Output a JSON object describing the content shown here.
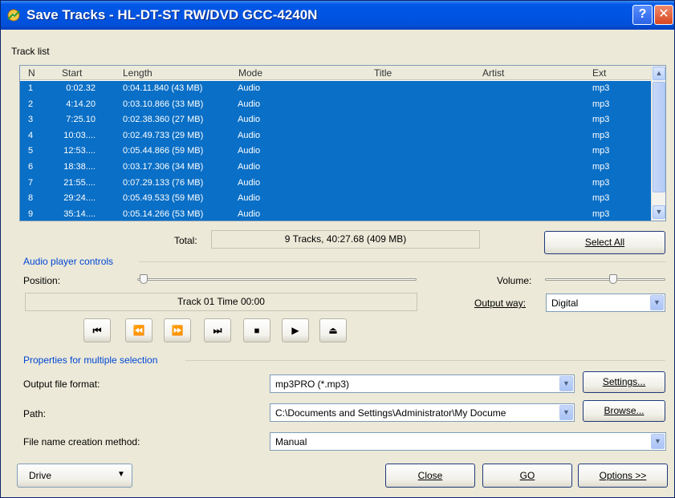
{
  "window": {
    "title": "Save Tracks - HL-DT-ST RW/DVD GCC-4240N",
    "help_label": "?",
    "close_label": "✕"
  },
  "track_list": {
    "label": "Track list",
    "columns": [
      "N",
      "Start",
      "Length",
      "Mode",
      "Title",
      "Artist",
      "Ext"
    ],
    "rows": [
      {
        "n": "1",
        "start": "0:02.32",
        "length": "0:04.11.840 (43 MB)",
        "mode": "Audio",
        "ext": "mp3"
      },
      {
        "n": "2",
        "start": "4:14.20",
        "length": "0:03.10.866 (33 MB)",
        "mode": "Audio",
        "ext": "mp3"
      },
      {
        "n": "3",
        "start": "7:25.10",
        "length": "0:02.38.360 (27 MB)",
        "mode": "Audio",
        "ext": "mp3"
      },
      {
        "n": "4",
        "start": "10:03....",
        "length": "0:02.49.733 (29 MB)",
        "mode": "Audio",
        "ext": "mp3"
      },
      {
        "n": "5",
        "start": "12:53....",
        "length": "0:05.44.866 (59 MB)",
        "mode": "Audio",
        "ext": "mp3"
      },
      {
        "n": "6",
        "start": "18:38....",
        "length": "0:03.17.306 (34 MB)",
        "mode": "Audio",
        "ext": "mp3"
      },
      {
        "n": "7",
        "start": "21:55....",
        "length": "0:07.29.133 (76 MB)",
        "mode": "Audio",
        "ext": "mp3"
      },
      {
        "n": "8",
        "start": "29:24....",
        "length": "0:05.49.533 (59 MB)",
        "mode": "Audio",
        "ext": "mp3"
      },
      {
        "n": "9",
        "start": "35:14....",
        "length": "0:05.14.266 (53 MB)",
        "mode": "Audio",
        "ext": "mp3"
      }
    ],
    "total_label": "Total:",
    "total_value": "9 Tracks,  40:27.68 (409 MB)",
    "select_all_label": "Select All"
  },
  "player": {
    "section_label": "Audio player controls",
    "position_label": "Position:",
    "volume_label": "Volume:",
    "status_text": "Track 01 Time 00:00",
    "output_way_label": "Output way:",
    "output_way_value": "Digital",
    "buttons": [
      "⏮",
      "⏪",
      "⏩",
      "⏭",
      "⏹",
      "▶",
      "⏏"
    ]
  },
  "properties": {
    "section_label": "Properties for multiple selection",
    "format_label": "Output file format:",
    "format_value": "mp3PRO (*.mp3)",
    "settings_label": "Settings...",
    "path_label": "Path:",
    "path_value": "C:\\Documents and Settings\\Administrator\\My Docume",
    "browse_label": "Browse...",
    "naming_label": "File name creation method:",
    "naming_value": "Manual"
  },
  "footer": {
    "drive_label": "Drive",
    "close_label": "Close",
    "go_label": "GO",
    "options_label": "Options >>"
  },
  "colors": {
    "selection": "#0a6fc6",
    "titlebar": "#0054e3",
    "section_text": "#0046d5"
  }
}
